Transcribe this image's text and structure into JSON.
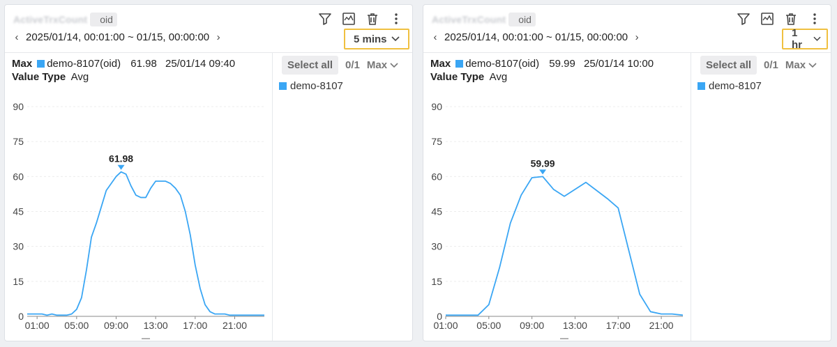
{
  "panels": [
    {
      "title": "ActiveTrxCount",
      "title_suffix": "oid",
      "time_range": "2025/01/14, 00:01:00 ~ 01/15, 00:00:00",
      "interval": "5 mins",
      "info": {
        "metric": "Max",
        "series_name": "demo-8107(oid)",
        "max_value": "61.98",
        "max_time": "25/01/14 09:40",
        "value_type_label": "Value Type",
        "value_type": "Avg"
      },
      "legend": {
        "select_all": "Select all",
        "count": "0/1",
        "sort": "Max",
        "items": [
          "demo-8107"
        ]
      },
      "peak_label": "61.98",
      "chart_data": {
        "type": "line",
        "x": [
          "00:00",
          "00:30",
          "01:00",
          "01:30",
          "02:00",
          "02:30",
          "03:00",
          "03:30",
          "04:00",
          "04:30",
          "05:00",
          "05:30",
          "06:00",
          "06:30",
          "07:00",
          "07:30",
          "08:00",
          "08:30",
          "09:00",
          "09:30",
          "10:00",
          "10:30",
          "11:00",
          "11:30",
          "12:00",
          "12:30",
          "13:00",
          "13:30",
          "14:00",
          "14:30",
          "15:00",
          "15:30",
          "16:00",
          "16:30",
          "17:00",
          "17:30",
          "18:00",
          "18:30",
          "19:00",
          "19:30",
          "20:00",
          "20:30",
          "21:00",
          "21:30",
          "22:00",
          "22:30",
          "23:00",
          "23:30",
          "24:00"
        ],
        "series": [
          {
            "name": "demo-8107",
            "color": "#3aa6f4",
            "values": [
              1,
              1,
              1,
              1,
              0.5,
              1,
              0.5,
              0.5,
              0.5,
              1,
              3,
              8,
              20,
              34,
              40,
              47,
              54,
              57,
              60,
              61.98,
              61,
              56,
              52,
              51,
              51,
              55,
              58,
              58,
              58,
              57,
              55,
              52,
              45,
              35,
              22,
              12,
              5,
              2,
              1,
              1,
              1,
              0.5,
              0.5,
              0.5,
              0.5,
              0.5,
              0.5,
              0.5,
              0.5
            ]
          }
        ],
        "y_ticks": [
          0,
          15,
          30,
          45,
          60,
          75,
          90
        ],
        "x_ticks": [
          "01:00",
          "05:00",
          "09:00",
          "13:00",
          "17:00",
          "21:00"
        ],
        "ylim": [
          0,
          90
        ],
        "grid": true
      }
    },
    {
      "title": "ActiveTrxCount",
      "title_suffix": "oid",
      "time_range": "2025/01/14, 00:01:00 ~ 01/15, 00:00:00",
      "interval": "1 hr",
      "info": {
        "metric": "Max",
        "series_name": "demo-8107(oid)",
        "max_value": "59.99",
        "max_time": "25/01/14 10:00",
        "value_type_label": "Value Type",
        "value_type": "Avg"
      },
      "legend": {
        "select_all": "Select all",
        "count": "0/1",
        "sort": "Max",
        "items": [
          "demo-8107"
        ]
      },
      "peak_label": "59.99",
      "chart_data": {
        "type": "line",
        "x": [
          "01:00",
          "02:00",
          "03:00",
          "04:00",
          "05:00",
          "06:00",
          "07:00",
          "08:00",
          "09:00",
          "10:00",
          "11:00",
          "12:00",
          "13:00",
          "14:00",
          "15:00",
          "16:00",
          "17:00",
          "18:00",
          "19:00",
          "20:00",
          "21:00",
          "22:00",
          "23:00"
        ],
        "series": [
          {
            "name": "demo-8107",
            "color": "#3aa6f4",
            "values": [
              0.5,
              0.5,
              0.5,
              0.5,
              5,
              21,
              40,
              52,
              59.5,
              59.99,
              54.5,
              51.5,
              54.5,
              57.5,
              54,
              50.5,
              46.5,
              28,
              9.5,
              2,
              1,
              1,
              0.5
            ]
          }
        ],
        "y_ticks": [
          0,
          15,
          30,
          45,
          60,
          75,
          90
        ],
        "x_ticks": [
          "01:00",
          "05:00",
          "09:00",
          "13:00",
          "17:00",
          "21:00"
        ],
        "ylim": [
          0,
          90
        ],
        "grid": true
      }
    }
  ]
}
